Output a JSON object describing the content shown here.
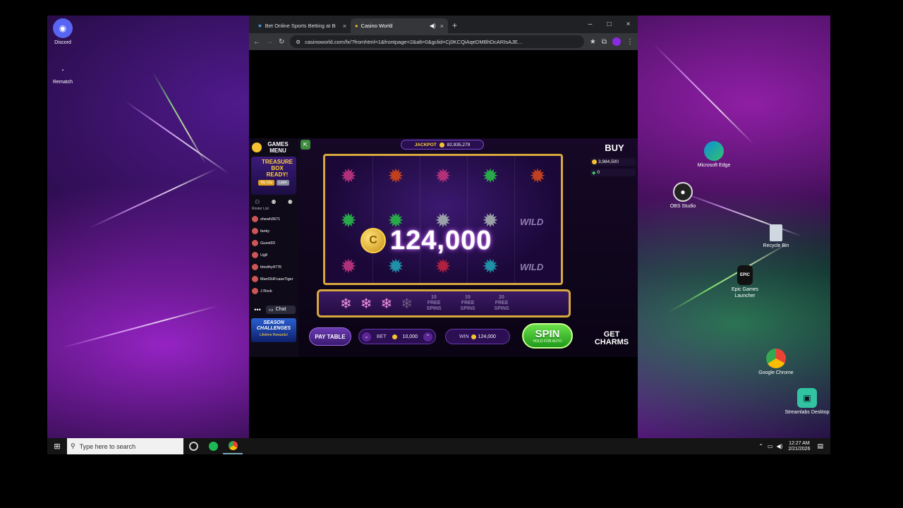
{
  "desktop": {
    "icons_left": [
      {
        "label": "Discord"
      },
      {
        "label": "Rematch"
      }
    ],
    "icons_right": [
      {
        "label": "Microsoft Edge"
      },
      {
        "label": "OBS Studio"
      },
      {
        "label": "Recycle Bin"
      },
      {
        "label": "Epic Games Launcher"
      },
      {
        "label": "Google Chrome"
      },
      {
        "label": "Streamlabs Desktop"
      }
    ]
  },
  "taskbar": {
    "search_placeholder": "Type here to search",
    "time": "12:27 AM",
    "date": "2/21/2026"
  },
  "browser": {
    "tabs": [
      {
        "label": "Bet Online Sports Betting at Be"
      },
      {
        "label": "Casino World"
      }
    ],
    "url": "casinoworld.com/fx/?fromhtml=1&frontpage=2&alt=0&gclid=Cj0KCQiAqeDMBhDcARIsAJE..."
  },
  "game": {
    "games_menu_label": "GAMES MENU",
    "treasure_box_text": "TREASURE BOX READY!",
    "my_city_label": "My City",
    "later_label": "Later",
    "roster_title": "Roster List",
    "players": [
      "shewh3671",
      "fanky",
      "Guest93",
      "Ug8",
      "timothy4776",
      "MarrDHFcaseTiger",
      "J Rock"
    ],
    "chat_label": "Chat",
    "season_text": "SEASON CHALLENGES",
    "season_sub": "Lifetime Rewards!",
    "jackpot_label": "JACKPOT",
    "jackpot_value": "82,935,279",
    "buy_label": "BUY",
    "coins": "3,984,500",
    "gems": "0",
    "win_amount": "124,000",
    "wild_label": "WILD",
    "free_spins": [
      {
        "count": "10",
        "label": "FREE SPINS"
      },
      {
        "count": "15",
        "label": "FREE SPINS"
      },
      {
        "count": "20",
        "label": "FREE SPINS"
      }
    ],
    "pay_table_label": "PAY TABLE",
    "bet_label": "BET",
    "bet_value": "10,000",
    "win_label": "WIN",
    "win_value": "124,000",
    "spin_label": "SPIN",
    "spin_sub": "HOLD FOR AUTO",
    "get_charms_label": "GET CHARMS"
  },
  "colors": {
    "accent_gold": "#d7a83c",
    "spin_green": "#2fbf1f",
    "bet_purple": "#5b2596"
  }
}
